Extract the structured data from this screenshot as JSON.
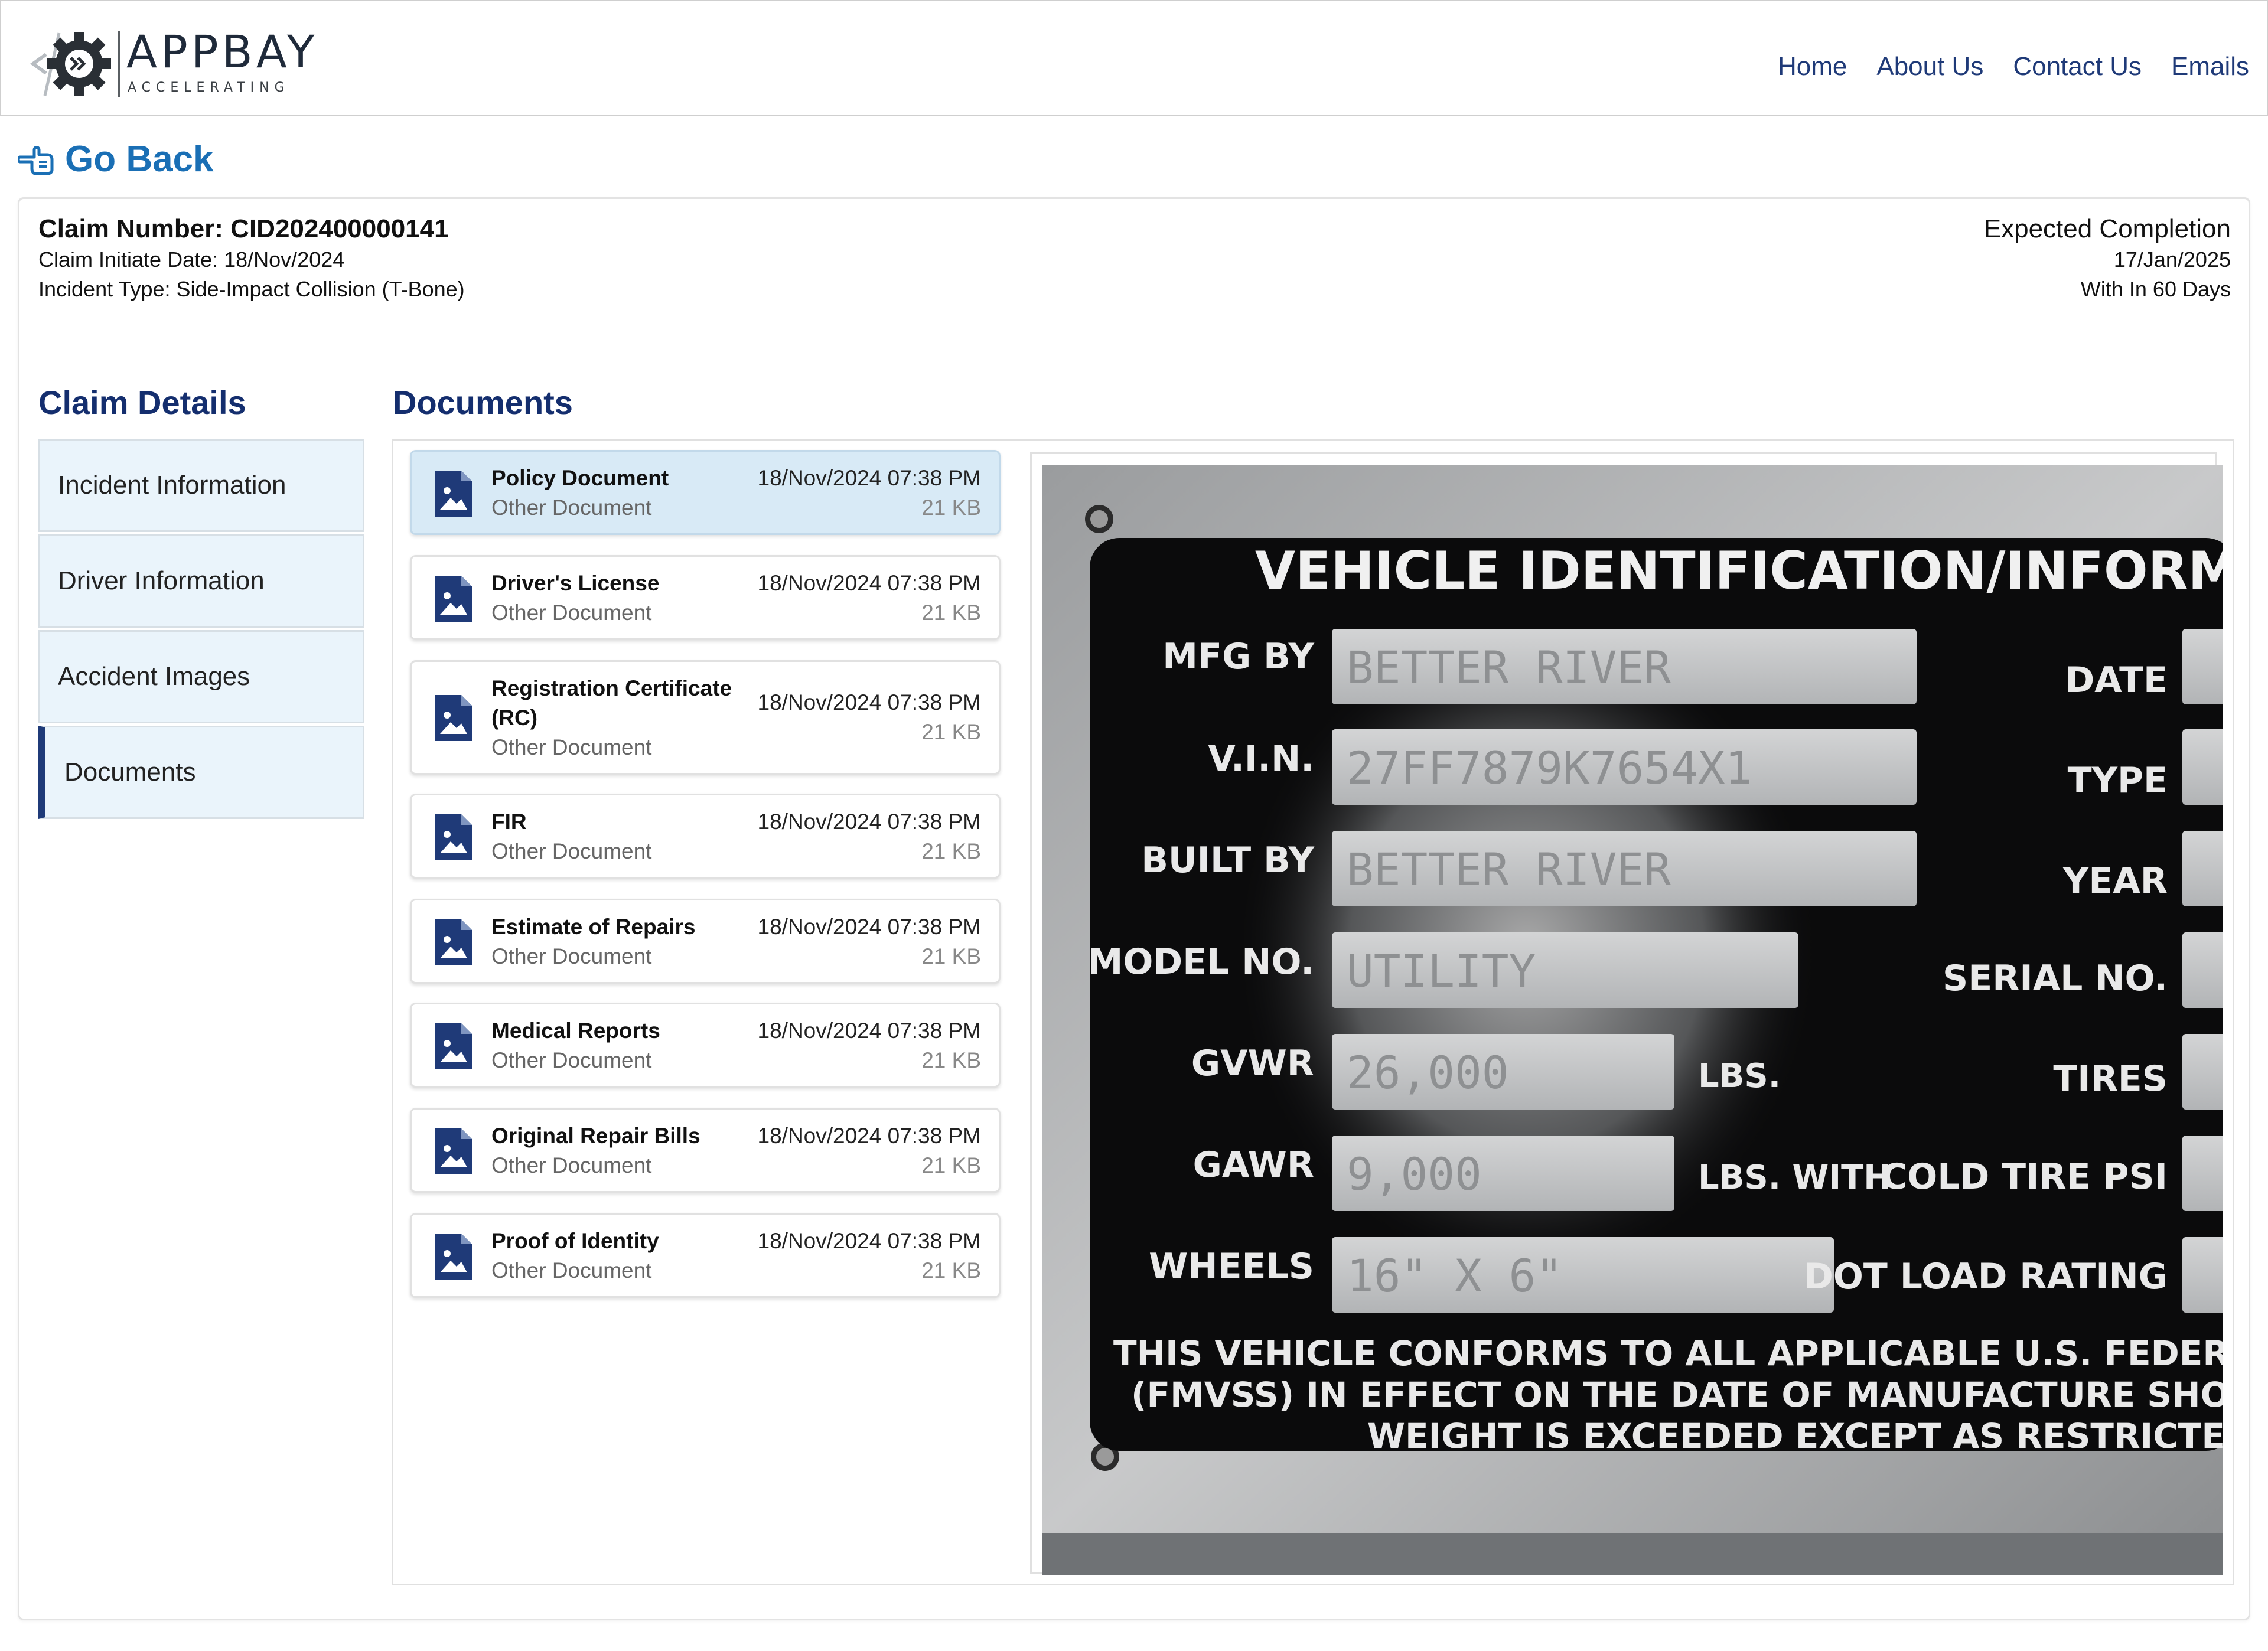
{
  "header": {
    "logo": {
      "wordmark": "APPBAY",
      "tagline": "ACCELERATING"
    },
    "nav": [
      "Home",
      "About Us",
      "Contact Us",
      "Emails"
    ]
  },
  "go_back": {
    "label": "Go Back"
  },
  "claim": {
    "number": "Claim Number: CID202400000141",
    "initiate_date": "Claim Initiate Date: 18/Nov/2024",
    "incident_type": "Incident Type: Side-Impact Collision (T-Bone)",
    "completion_label": "Expected Completion",
    "completion_date": "17/Jan/2025",
    "completion_window": "With In 60 Days"
  },
  "claim_details": {
    "title": "Claim Details",
    "items": [
      "Incident Information",
      "Driver Information",
      "Accident Images",
      "Documents"
    ],
    "active": "Documents"
  },
  "documents": {
    "title": "Documents",
    "items": [
      {
        "name": "Policy Document",
        "type": "Other Document",
        "date": "18/Nov/2024 07:38 PM",
        "size": "21 KB",
        "selected": true
      },
      {
        "name": "Driver's License",
        "type": "Other Document",
        "date": "18/Nov/2024 07:38 PM",
        "size": "21 KB"
      },
      {
        "name": "Registration Certificate (RC)",
        "type": "Other Document",
        "date": "18/Nov/2024 07:38 PM",
        "size": "21 KB"
      },
      {
        "name": "FIR",
        "type": "Other Document",
        "date": "18/Nov/2024 07:38 PM",
        "size": "21 KB"
      },
      {
        "name": "Estimate of Repairs",
        "type": "Other Document",
        "date": "18/Nov/2024 07:38 PM",
        "size": "21 KB"
      },
      {
        "name": "Medical Reports",
        "type": "Other Document",
        "date": "18/Nov/2024 07:38 PM",
        "size": "21 KB"
      },
      {
        "name": "Original Repair Bills",
        "type": "Other Document",
        "date": "18/Nov/2024 07:38 PM",
        "size": "21 KB"
      },
      {
        "name": "Proof of Identity",
        "type": "Other Document",
        "date": "18/Nov/2024 07:38 PM",
        "size": "21 KB"
      }
    ]
  },
  "preview": {
    "plate_title": "VEHICLE IDENTIFICATION/INFORMAT",
    "left_labels": [
      "MFG BY",
      "V.I.N.",
      "BUILT BY",
      "MODEL NO.",
      "GVWR",
      "GAWR",
      "WHEELS"
    ],
    "left_values": [
      "BETTER RIVER",
      "27FF7879K7654X1",
      "BETTER RIVER",
      "UTILITY",
      "26,000",
      "9,000",
      "16\" X 6\""
    ],
    "unit_labels": [
      "LBS.",
      "LBS. WITH"
    ],
    "right_labels": [
      "DATE",
      "TYPE",
      "YEAR",
      "SERIAL NO.",
      "TIRES",
      "COLD TIRE PSI",
      "DOT LOAD RATING"
    ],
    "footer_lines": [
      "THIS VEHICLE CONFORMS TO ALL APPLICABLE U.S. FEDERAL MOTOR VE",
      "(FMVSS) IN EFFECT ON THE DATE OF MANUFACTURE SHOWN ABOVE. V",
      "WEIGHT IS EXCEEDED EXCEPT AS RESTRICTED BY TIRES"
    ]
  },
  "colors": {
    "nav": "#1f3a78",
    "go_back": "#1a6fb5",
    "section_title": "#142e6e",
    "sidebar_bg": "#eaf4fb",
    "selected_doc_bg": "#d8eaf6",
    "doc_icon": "#1f3a78"
  },
  "icons": {
    "go_back": "hand-pointing-left-icon",
    "document": "image-file-icon",
    "logo": "gear-logo-icon"
  }
}
